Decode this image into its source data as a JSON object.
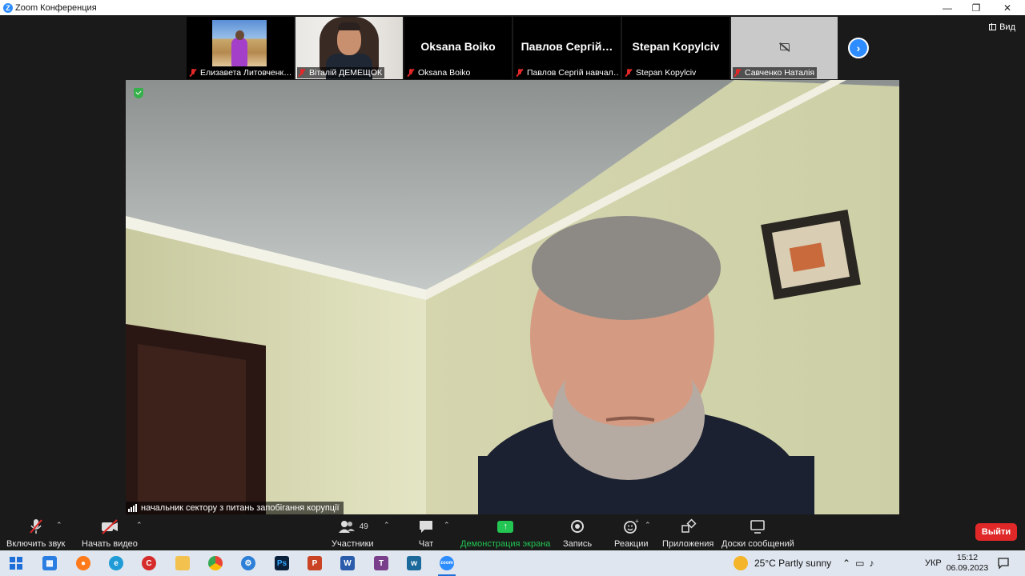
{
  "window": {
    "title": "Zoom Конференция",
    "controls": {
      "minimize": "—",
      "maximize": "❐",
      "close": "✕"
    }
  },
  "view_button": {
    "label": "Вид"
  },
  "participants_strip": [
    {
      "name_label": "Елизавета Литовченк…",
      "video": "on",
      "muted": true
    },
    {
      "name_label": "Віталій ДЕМЕЩОК",
      "video": "on",
      "muted": true
    },
    {
      "display_name": "Oksana Boiko",
      "name_label": "Oksana Boiko",
      "video": "off",
      "muted": true
    },
    {
      "display_name": "Павлов Сергій…",
      "name_label": "Павлов Сергій навчал…",
      "video": "off",
      "muted": true
    },
    {
      "display_name": "Stepan Kopylciv",
      "name_label": "Stepan Kopylciv",
      "video": "off",
      "muted": true
    },
    {
      "name_label": "Савченко Наталія",
      "video": "off-camera-disabled",
      "muted": true
    }
  ],
  "next_page_icon": "chevron-right-icon",
  "active_speaker": {
    "name_label": "начальник сектору з питань запобігання корупції"
  },
  "toolbar": {
    "unmute": "Включить звук",
    "start_video": "Начать видео",
    "participants": "Участники",
    "participants_count": "49",
    "chat": "Чат",
    "share_screen": "Демонстрация экрана",
    "record": "Запись",
    "reactions": "Реакции",
    "apps": "Приложения",
    "whiteboards": "Доски сообщений",
    "leave": "Выйти"
  },
  "taskbar": {
    "apps": [
      "windows-start",
      "calendar",
      "firefox",
      "edge",
      "app-red",
      "file-explorer",
      "chrome",
      "settings",
      "photoshop",
      "powerpoint",
      "word",
      "app-teams",
      "webex",
      "zoom"
    ],
    "weather": "25°C  Partly sunny",
    "language": "УКР",
    "time": "15:12",
    "date": "06.09.2023"
  },
  "colors": {
    "zoom_blue": "#2d8cff",
    "share_green": "#23c553",
    "leave_red": "#e02828",
    "muted_red": "#e02828"
  }
}
